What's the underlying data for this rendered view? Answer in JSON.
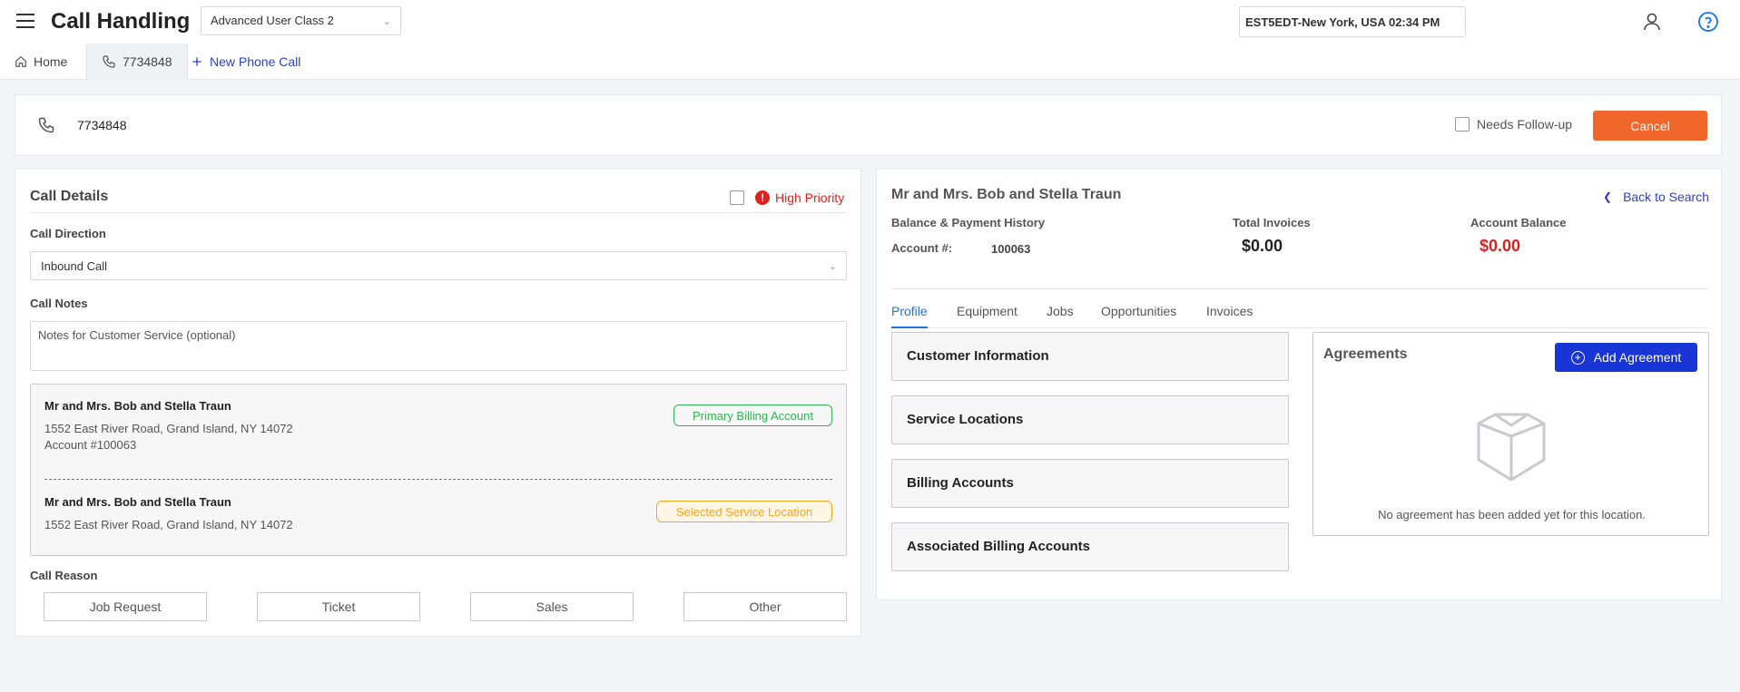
{
  "header": {
    "title": "Call Handling",
    "user_class": "Advanced User Class 2",
    "timezone": "EST5EDT-New York, USA 02:34 PM"
  },
  "tabs": {
    "home": "Home",
    "call": "7734848",
    "new_call": "New Phone Call"
  },
  "callbar": {
    "phone_number": "7734848",
    "needs_followup": "Needs Follow-up",
    "cancel": "Cancel"
  },
  "call_details": {
    "title": "Call Details",
    "high_priority": "High Priority",
    "direction_label": "Call Direction",
    "direction_value": "Inbound Call",
    "notes_label": "Call Notes",
    "notes_placeholder": "Notes for Customer Service (optional)",
    "billing": {
      "name": "Mr and Mrs. Bob and Stella Traun",
      "address": "1552 East River Road, Grand Island, NY 14072",
      "account": "Account #100063",
      "badge": "Primary Billing Account"
    },
    "service": {
      "name": "Mr and Mrs. Bob and Stella Traun",
      "address": "1552 East River Road, Grand Island, NY 14072",
      "badge": "Selected Service Location"
    },
    "reason_label": "Call Reason",
    "reasons": [
      "Job Request",
      "Ticket",
      "Sales",
      "Other"
    ]
  },
  "customer": {
    "name": "Mr and Mrs. Bob and Stella Traun",
    "back": "Back to Search",
    "balance_history": "Balance & Payment History",
    "account_label": "Account #:",
    "account_number": "100063",
    "total_invoices_label": "Total Invoices",
    "total_invoices": "$0.00",
    "account_balance_label": "Account Balance",
    "account_balance": "$0.00",
    "tabs": [
      "Profile",
      "Equipment",
      "Jobs",
      "Opportunities",
      "Invoices"
    ],
    "sections": [
      "Customer Information",
      "Service Locations",
      "Billing Accounts",
      "Associated Billing Accounts"
    ],
    "agreements_title": "Agreements",
    "add_agreement": "Add Agreement",
    "empty_text": "No agreement has been added yet for this location."
  },
  "colors": {
    "accent": "#f0662b",
    "primary": "#1a35d6",
    "link": "#2b3fc9",
    "danger": "#e02020",
    "success": "#30b352",
    "warning": "#f5a623"
  }
}
